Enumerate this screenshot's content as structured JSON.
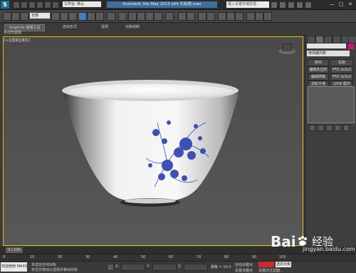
{
  "app": {
    "logo": "S",
    "title": "Autodesk 3ds Max 2013 x64 无标题.max",
    "workspace": "工作台: 默认",
    "search_placeholder": "键入关键字或短语",
    "window_controls": [
      "—",
      "□",
      "✕"
    ]
  },
  "toolbar": {
    "selection_filter": "全部"
  },
  "ribbon": {
    "tabs": [
      "Graphite 建模工具",
      "自由形式",
      "选择",
      "对象绘制"
    ],
    "subtitle": "多边形建模"
  },
  "viewport": {
    "label": "[+][透视][真实]",
    "accent_color": "#e0c000",
    "object": "porcelain-bowl-with-blue-floral-pattern"
  },
  "command_panel": {
    "modifier_list": "修改器列表",
    "buttons": [
      "挤出",
      "车削",
      "编辑多边形",
      "FFD 2x2x2",
      "编辑网格",
      "FFD 3x3x3",
      "涡轮平滑",
      "UVW 展开"
    ],
    "swatch_color": "#d3137a"
  },
  "timeline": {
    "frame": "0 / 100",
    "ticks": [
      "0",
      "10",
      "20",
      "30",
      "40",
      "50",
      "60",
      "70",
      "80",
      "90",
      "100"
    ]
  },
  "status": {
    "maxscript": "欢迎使用 MAXS",
    "line1": "未选定任何对象",
    "line2": "单击并拖动以选择并移动对象",
    "x": "X:",
    "y": "Y:",
    "z": "Z:",
    "grid": "栅格 = 10.0",
    "auto_key": "自动关键点",
    "selected": "选定对象",
    "set_key": "设置关键点",
    "key_filter": "关键点过滤器..."
  },
  "watermark": {
    "brand": "Bai",
    "brand_suffix": "经验",
    "url": "jingyan.baidu.com"
  }
}
